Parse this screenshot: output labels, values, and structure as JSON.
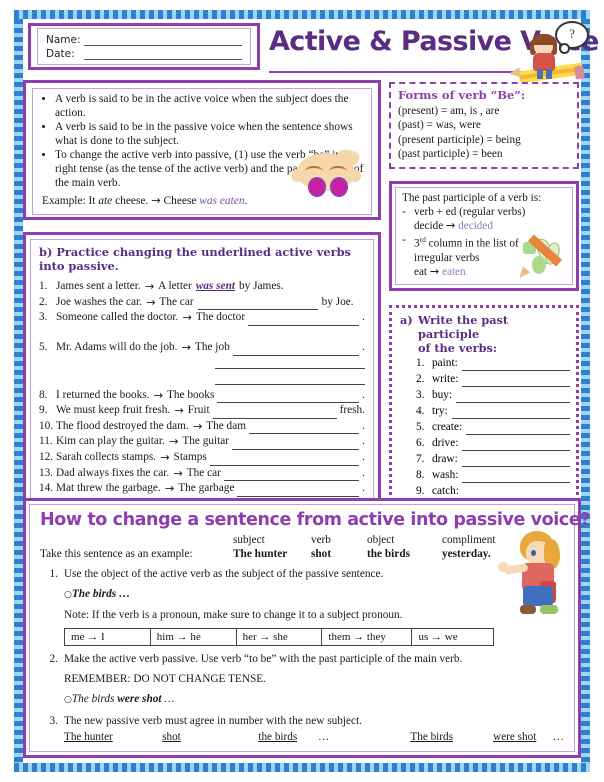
{
  "header": {
    "name_label": "Name:",
    "date_label": "Date:",
    "title": "Active & Passive Voice",
    "thought_bubble": "?"
  },
  "definitions": {
    "bullets": [
      "A verb is said to be in the active voice when the subject does the action.",
      "A verb is said to be in the passive voice when the sentence shows what is done to the subject.",
      "To change the active verb into passive, (1) use the verb “be” in the right tense (as the tense of the active verb) and the past participle of the main verb."
    ],
    "example_prefix": "Example: It ",
    "example_verb": "ate",
    "example_mid": " cheese. ",
    "example_arrow": "→",
    "example_result_prefix": " Cheese ",
    "example_result_verb": "was eaten",
    "example_end": "."
  },
  "be_forms": {
    "title": "Forms of verb “Be”:",
    "lines": [
      "(present) = am, is , are",
      "(past) = was, were",
      "(present participle) = being",
      "(past participle) = been"
    ]
  },
  "past_participle": {
    "intro": "The past participle of a verb is:",
    "item1_dash": "-",
    "item1": "verb + ed (regular verbs)",
    "item1_ex_prefix": "decide ",
    "item1_ex_arrow": "→",
    "item1_ex_result": " decided",
    "item2_dash": "-",
    "item2_sup_num": "3",
    "item2_sup": "rd",
    "item2": " column in the list of",
    "item2_line2": "irregular verbs",
    "item2_ex_prefix": "eat ",
    "item2_ex_arrow": "→",
    "item2_ex_result": " eaten"
  },
  "section_a": {
    "marker": "a)",
    "title_line1": "Write the past participle",
    "title_line2": "of the verbs:",
    "items": [
      {
        "num": "1.",
        "verb": "paint:"
      },
      {
        "num": "2.",
        "verb": "write:"
      },
      {
        "num": "3.",
        "verb": "buy:"
      },
      {
        "num": "4.",
        "verb": "try:"
      },
      {
        "num": "5.",
        "verb": "create:"
      },
      {
        "num": "6.",
        "verb": "drive:"
      },
      {
        "num": "7.",
        "verb": "draw:"
      },
      {
        "num": "8.",
        "verb": "wash:"
      },
      {
        "num": "9.",
        "verb": "catch:"
      }
    ]
  },
  "section_b": {
    "marker": "b)",
    "title": "Practice changing the underlined active verbs into passive.",
    "items": [
      {
        "num": "1.",
        "active": "James sent a letter.",
        "arrow": "→",
        "passive_start": "A letter",
        "answer": "was sent",
        "tail": "by James.",
        "type": "answered"
      },
      {
        "num": "2.",
        "active": "Joe washes the car.",
        "arrow": "→",
        "passive_start": "The car",
        "tail": "by Joe.",
        "type": "midblank"
      },
      {
        "num": "3.",
        "active": "Someone called the doctor.",
        "arrow": "→",
        "passive_start": "The doctor",
        "tail": ".",
        "type": "endblank"
      },
      {
        "num": "5.",
        "active": "Mr. Adams will do the job.",
        "arrow": "→",
        "passive_start": "The job",
        "tail": ".",
        "type": "endblank"
      },
      {
        "num": "8.",
        "active": "I returned the books.",
        "arrow": "→",
        "passive_start": "The books",
        "tail": ".",
        "type": "endblank"
      },
      {
        "num": "9.",
        "active": "We must keep fruit fresh.",
        "arrow": "→",
        "passive_start": "Fruit",
        "tail": "fresh.",
        "type": "midblank"
      },
      {
        "num": "10.",
        "active": "The flood destroyed the dam.",
        "arrow": "→",
        "passive_start": "The dam",
        "tail": ".",
        "type": "endblank"
      },
      {
        "num": "11.",
        "active": "Kim can play the guitar.",
        "arrow": "→",
        "passive_start": "The guitar",
        "tail": ".",
        "type": "endblank"
      },
      {
        "num": "12.",
        "active": "Sarah collects stamps.",
        "arrow": "→",
        "passive_start": "Stamps",
        "tail": ".",
        "type": "endblank"
      },
      {
        "num": "13.",
        "active": "Dad always fixes the car.",
        "arrow": "→",
        "passive_start": "The car",
        "tail": ".",
        "type": "endblank"
      },
      {
        "num": "14.",
        "active": "Mat threw the garbage.",
        "arrow": "→",
        "passive_start": "The garbage",
        "tail": ".",
        "type": "endblank"
      }
    ]
  },
  "bottom": {
    "title": "How to change a sentence from active into passive voice?",
    "example_labels": [
      "subject",
      "verb",
      "object",
      "compliment"
    ],
    "example_intro": "Take this sentence as an example:",
    "example_words": [
      "The hunter",
      "shot",
      "the birds",
      "yesterday."
    ],
    "step1_num": "1.",
    "step1": "Use the object of the active verb as the subject of the passive sentence.",
    "step1_bullet": "○",
    "step1_sub": "The birds …",
    "step1_note": "Note: If the verb is a pronoun, make sure to change it to a subject pronoun.",
    "pronoun_table": [
      "me → I",
      "him → he",
      "her → she",
      "them → they",
      "us → we"
    ],
    "step2_num": "2.",
    "step2": "Make the active verb passive. Use verb “to be” with the past participle of the main verb.",
    "step2_remember": "REMEMBER: DO NOT CHANGE TENSE.",
    "step2_bullet": "○",
    "step2_sub_a": "The birds ",
    "step2_sub_b": "were shot",
    "step2_sub_c": " …",
    "step3_num": "3.",
    "step3": "The new passive verb must agree in number with the new subject.",
    "step3_words": [
      "The hunter",
      "shot",
      "the birds",
      "The birds",
      "were shot"
    ],
    "step3_ellipsis": "…"
  },
  "colors": {
    "purple": "#8e3fae",
    "dark_purple": "#5b2d82",
    "light_purple": "#8f79c0",
    "blue_border": "#2f7fd0"
  }
}
